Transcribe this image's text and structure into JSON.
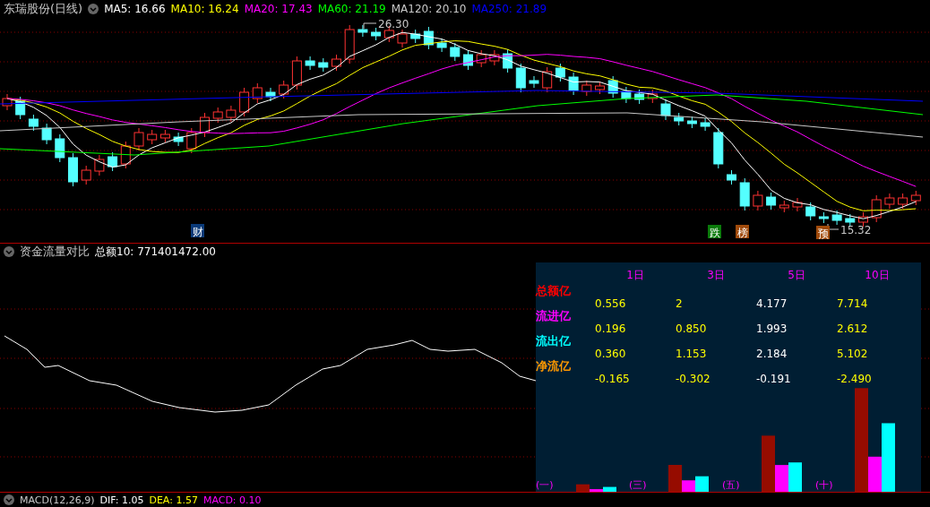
{
  "main_chart": {
    "stock_name": "东瑞股份(日线)",
    "indicators": [
      {
        "label": "MA5: 16.66",
        "color": "#ffffff"
      },
      {
        "label": "MA10: 16.24",
        "color": "#ffff00"
      },
      {
        "label": "MA20: 17.43",
        "color": "#ff00ff"
      },
      {
        "label": "MA60: 21.19",
        "color": "#00ff00"
      },
      {
        "label": "MA120: 20.10",
        "color": "#c8c8c8"
      },
      {
        "label": "MA250: 21.89",
        "color": "#0000ff"
      }
    ],
    "high_label": "26.30",
    "low_label": "15.32",
    "event_markers": [
      {
        "text": "财",
        "color": "#0a3a78"
      },
      {
        "text": "跌",
        "color": "#0a7a0a"
      },
      {
        "text": "榜",
        "color": "#a04a0a"
      },
      {
        "text": "预",
        "color": "#a04a0a"
      }
    ]
  },
  "flow_panel": {
    "title": "资金流量对比",
    "value": "总额10: 771401472.00",
    "table": {
      "columns": [
        {
          "label": "1日",
          "color": "#ffff00"
        },
        {
          "label": "3日",
          "color": "#ffff00"
        },
        {
          "label": "5日",
          "color": "#ffffff"
        },
        {
          "label": "10日",
          "color": "#ffff00"
        }
      ],
      "rows": [
        {
          "label": "总额亿",
          "color": "#ff0000",
          "cells": [
            "0.556",
            "2",
            "4.177",
            "7.714"
          ]
        },
        {
          "label": "流进亿",
          "color": "#ff00ff",
          "cells": [
            "0.196",
            "0.850",
            "1.993",
            "2.612"
          ]
        },
        {
          "label": "流出亿",
          "color": "#00ffff",
          "cells": [
            "0.360",
            "1.153",
            "2.184",
            "5.102"
          ]
        },
        {
          "label": "净流亿",
          "color": "#ff9900",
          "cells": [
            "-0.165",
            "-0.302",
            "-0.191",
            "-2.490"
          ]
        }
      ]
    },
    "bar_labels": [
      "(一)",
      "(三)",
      "(五)",
      "(十)"
    ]
  },
  "macd_panel": {
    "title": "MACD(12,26,9)",
    "indicators": [
      {
        "label": "DIF: 1.05",
        "color": "#ffffff"
      },
      {
        "label": "DEA: 1.57",
        "color": "#ffff00"
      },
      {
        "label": "MACD: 0.10",
        "color": "#ff00ff"
      }
    ]
  }
}
